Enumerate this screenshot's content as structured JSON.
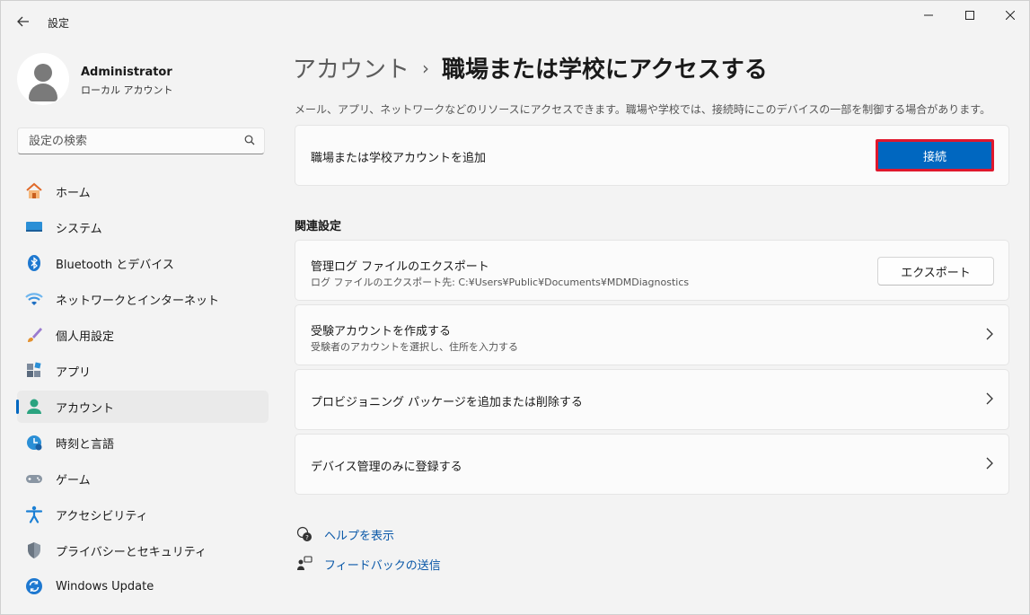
{
  "window": {
    "title": "設定",
    "controls": {
      "minimize": "—",
      "maximize": "☐",
      "close": "✕"
    }
  },
  "user": {
    "name": "Administrator",
    "account_type": "ローカル アカウント"
  },
  "search": {
    "placeholder": "設定の検索"
  },
  "sidebar": {
    "items": [
      {
        "label": "ホーム",
        "icon": "home-icon"
      },
      {
        "label": "システム",
        "icon": "system-icon"
      },
      {
        "label": "Bluetooth とデバイス",
        "icon": "bluetooth-icon"
      },
      {
        "label": "ネットワークとインターネット",
        "icon": "network-icon"
      },
      {
        "label": "個人用設定",
        "icon": "brush-icon"
      },
      {
        "label": "アプリ",
        "icon": "apps-icon"
      },
      {
        "label": "アカウント",
        "icon": "account-icon",
        "active": true
      },
      {
        "label": "時刻と言語",
        "icon": "time-language-icon"
      },
      {
        "label": "ゲーム",
        "icon": "gamepad-icon"
      },
      {
        "label": "アクセシビリティ",
        "icon": "accessibility-icon"
      },
      {
        "label": "プライバシーとセキュリティ",
        "icon": "shield-icon"
      },
      {
        "label": "Windows Update",
        "icon": "update-icon"
      }
    ]
  },
  "breadcrumb": {
    "parent": "アカウント",
    "separator": "›",
    "current": "職場または学校にアクセスする"
  },
  "description": "メール、アプリ、ネットワークなどのリソースにアクセスできます。職場や学校では、接続時にこのデバイスの一部を制御する場合があります。",
  "add_account": {
    "label": "職場または学校アカウントを追加",
    "button": "接続"
  },
  "related": {
    "title": "関連設定",
    "export": {
      "title": "管理ログ ファイルのエクスポート",
      "subtitle": "ログ ファイルのエクスポート先: C:¥Users¥Public¥Documents¥MDMDiagnostics",
      "button": "エクスポート"
    },
    "exam": {
      "title": "受験アカウントを作成する",
      "subtitle": "受験者のアカウントを選択し、住所を入力する"
    },
    "provisioning": {
      "title": "プロビジョニング パッケージを追加または削除する"
    },
    "mdm_only": {
      "title": "デバイス管理のみに登録する"
    }
  },
  "help": {
    "help_label": "ヘルプを表示",
    "feedback_label": "フィードバックの送信"
  },
  "colors": {
    "accent": "#0067c0",
    "highlight_border": "#e0182d",
    "link": "#0a58a8"
  }
}
